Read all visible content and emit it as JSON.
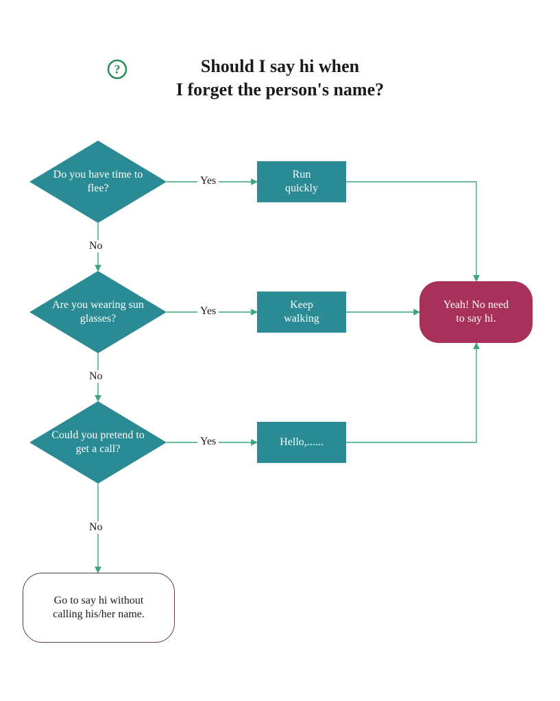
{
  "chart_data": {
    "type": "flowchart",
    "title": "Should I say hi when\nI forget the person's name?",
    "nodes": [
      {
        "id": "d1",
        "kind": "decision",
        "text": "Do you have time to flee?"
      },
      {
        "id": "d2",
        "kind": "decision",
        "text": "Are you wearing sun glasses?"
      },
      {
        "id": "d3",
        "kind": "decision",
        "text": "Could you pretend to get a call?"
      },
      {
        "id": "p1",
        "kind": "process",
        "text": "Run quickly"
      },
      {
        "id": "p2",
        "kind": "process",
        "text": "Keep walking"
      },
      {
        "id": "p3",
        "kind": "process",
        "text": "Hello,......"
      },
      {
        "id": "t1",
        "kind": "terminator",
        "text": "Yeah! No need to say hi."
      },
      {
        "id": "t2",
        "kind": "terminator",
        "text": "Go to say hi without calling his/her name."
      }
    ],
    "edges": [
      {
        "from": "d1",
        "to": "p1",
        "label": "Yes"
      },
      {
        "from": "d1",
        "to": "d2",
        "label": "No"
      },
      {
        "from": "d2",
        "to": "p2",
        "label": "Yes"
      },
      {
        "from": "d2",
        "to": "d3",
        "label": "No"
      },
      {
        "from": "d3",
        "to": "p3",
        "label": "Yes"
      },
      {
        "from": "d3",
        "to": "t2",
        "label": "No"
      },
      {
        "from": "p1",
        "to": "t1",
        "label": ""
      },
      {
        "from": "p2",
        "to": "t1",
        "label": ""
      },
      {
        "from": "p3",
        "to": "t1",
        "label": ""
      }
    ]
  },
  "title_line1": "Should I say hi when",
  "title_line2": "I forget the person's name?",
  "question_icon": "?",
  "d1": "Do you have time to flee?",
  "d2": "Are you wearing sun glasses?",
  "d3": "Could you pretend to get a call?",
  "p1": "Run quickly",
  "p2": "Keep walking",
  "p3": "Hello,......",
  "t1": "Yeah! No need to say hi.",
  "t2": "Go to say hi without calling his/her name.",
  "labels": {
    "yes1": "Yes",
    "no1": "No",
    "yes2": "Yes",
    "no2": "No",
    "yes3": "Yes",
    "no3": "No"
  },
  "colors": {
    "teal": "#2a8b94",
    "pink": "#a7315a",
    "arrow": "#3aa47a"
  }
}
